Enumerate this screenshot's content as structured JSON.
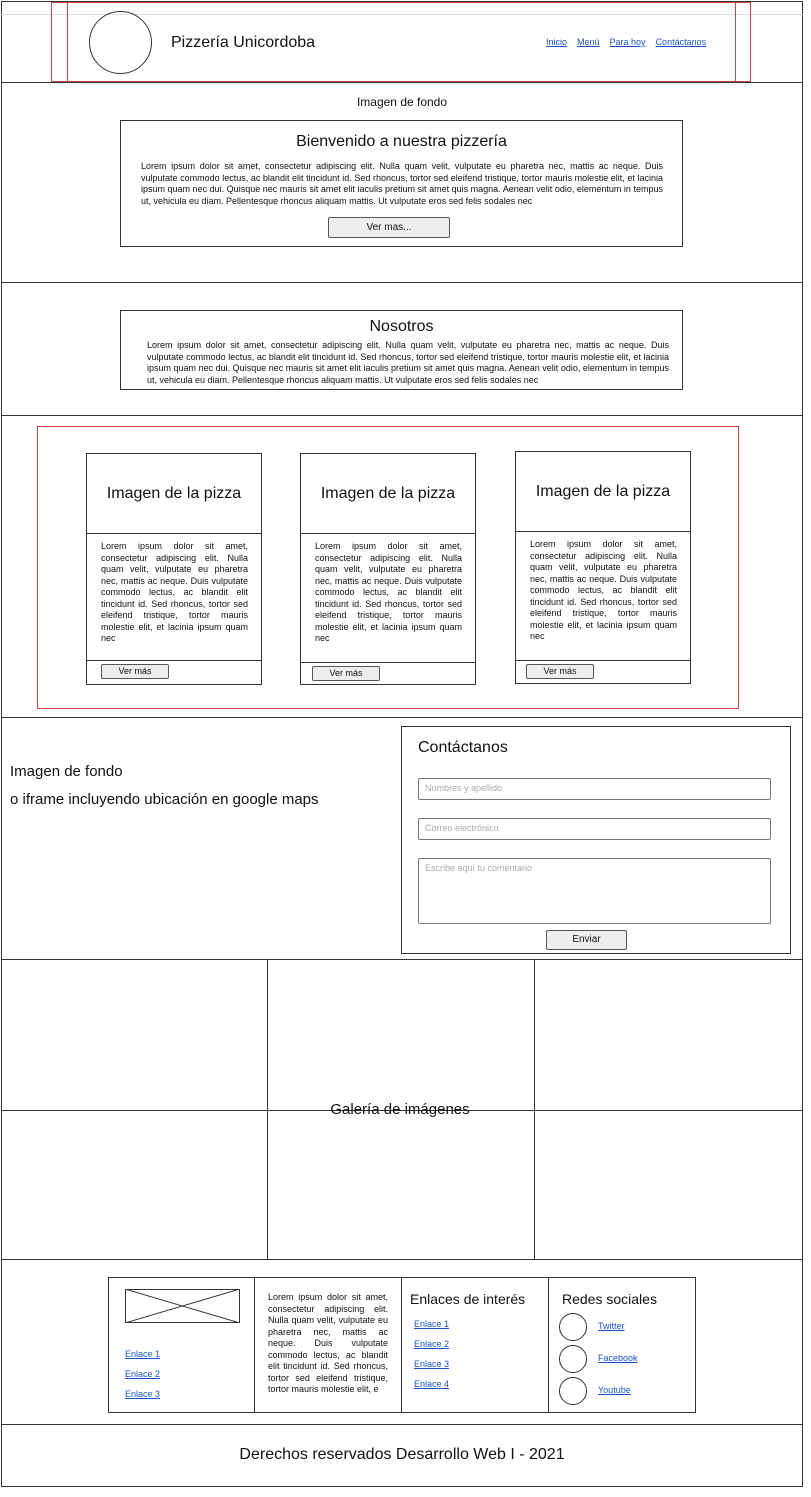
{
  "header": {
    "title": "Pizzería Unicordoba",
    "nav": [
      "Inicio",
      "Menú",
      "Para hoy",
      "Contáctanos"
    ]
  },
  "hero": {
    "bg_label": "Imagen de fondo",
    "title": "Bienvenido a nuestra pizzería",
    "text": "Lorem ipsum dolor sit amet, consectetur adipiscing elit. Nulla quam velit, vulputate eu pharetra nec, mattis ac neque. Duis vulputate commodo lectus, ac blandit elit tincidunt id. Sed rhoncus, tortor sed eleifend tristique, tortor mauris molestie elit, et lacinia ipsum quam nec dui. Quisque nec mauris sit amet elit iaculis pretium sit amet quis magna. Aenean velit odio, elementum in tempus ut, vehicula eu diam. Pellentesque rhoncus aliquam mattis. Ut vulputate eros sed felis sodales nec",
    "button": "Ver mas..."
  },
  "about": {
    "title": "Nosotros",
    "text": "Lorem ipsum dolor sit amet, consectetur adipiscing elit. Nulla quam velit, vulputate eu pharetra nec, mattis ac neque. Duis vulputate commodo lectus, ac blandit elit tincidunt id. Sed rhoncus, tortor sed eleifend tristique, tortor mauris molestie elit, et lacinia ipsum quam nec dui. Quisque nec mauris sit amet elit iaculis pretium sit amet quis magna. Aenean velit odio, elementum in tempus ut, vehicula eu diam. Pellentesque rhoncus aliquam mattis. Ut vulputate eros sed felis sodales nec"
  },
  "pizzas": [
    {
      "image": "Imagen de la pizza",
      "text": "Lorem ipsum dolor sit amet, consectetur adipiscing elit. Nulla quam velit, vulputate eu pharetra nec, mattis ac neque. Duis vulputate commodo lectus, ac blandit elit tincidunt id. Sed rhoncus, tortor sed eleifend tristique, tortor mauris molestie elit, et lacinia ipsum quam nec",
      "button": "Ver más"
    },
    {
      "image": "Imagen de la pizza",
      "text": "Lorem ipsum dolor sit amet, consectetur adipiscing elit. Nulla quam velit, vulputate eu pharetra nec, mattis ac neque. Duis vulputate commodo lectus, ac blandit elit tincidunt id. Sed rhoncus, tortor sed eleifend tristique, tortor mauris molestie elit, et lacinia ipsum quam nec",
      "button": "Ver más"
    },
    {
      "image": "Imagen de la pizza",
      "text": "Lorem ipsum dolor sit amet, consectetur adipiscing elit. Nulla quam velit, vulputate eu pharetra nec, mattis ac neque. Duis vulputate commodo lectus, ac blandit elit tincidunt id. Sed rhoncus, tortor sed eleifend tristique, tortor mauris molestie elit, et lacinia ipsum quam nec",
      "button": "Ver más"
    }
  ],
  "contact": {
    "bg_line1": "Imagen de fondo",
    "bg_line2": "o iframe incluyendo ubicación en google maps",
    "title": "Contáctanos",
    "name_placeholder": "Nombres y apellido",
    "email_placeholder": "Correo electrónico",
    "comment_placeholder": "Escribe aquí tu comentario",
    "button": "Enviar"
  },
  "gallery": {
    "label": "Galería de imágenes"
  },
  "footer": {
    "links": [
      "Enlace 1",
      "Enlace 2",
      "Enlace 3"
    ],
    "text": "Lorem ipsum dolor sit amet, consectetur adipiscing elit. Nulla quam velit, vulputate eu pharetra nec, mattis ac neque. Duis vulputate commodo lectus, ac blandit elit tincidunt id. Sed rhoncus, tortor sed eleifend tristique, tortor mauris molestie elit, e",
    "interest_title": "Enlaces de interés",
    "interest_links": [
      "Enlace 1",
      "Enlace 2",
      "Enlace 3",
      "Enlace 4"
    ],
    "social_title": "Redes sociales",
    "social": [
      "Twitter",
      "Facebook",
      "Youtube"
    ]
  },
  "copyright": "Derechos reservados Desarrollo Web I - 2021"
}
